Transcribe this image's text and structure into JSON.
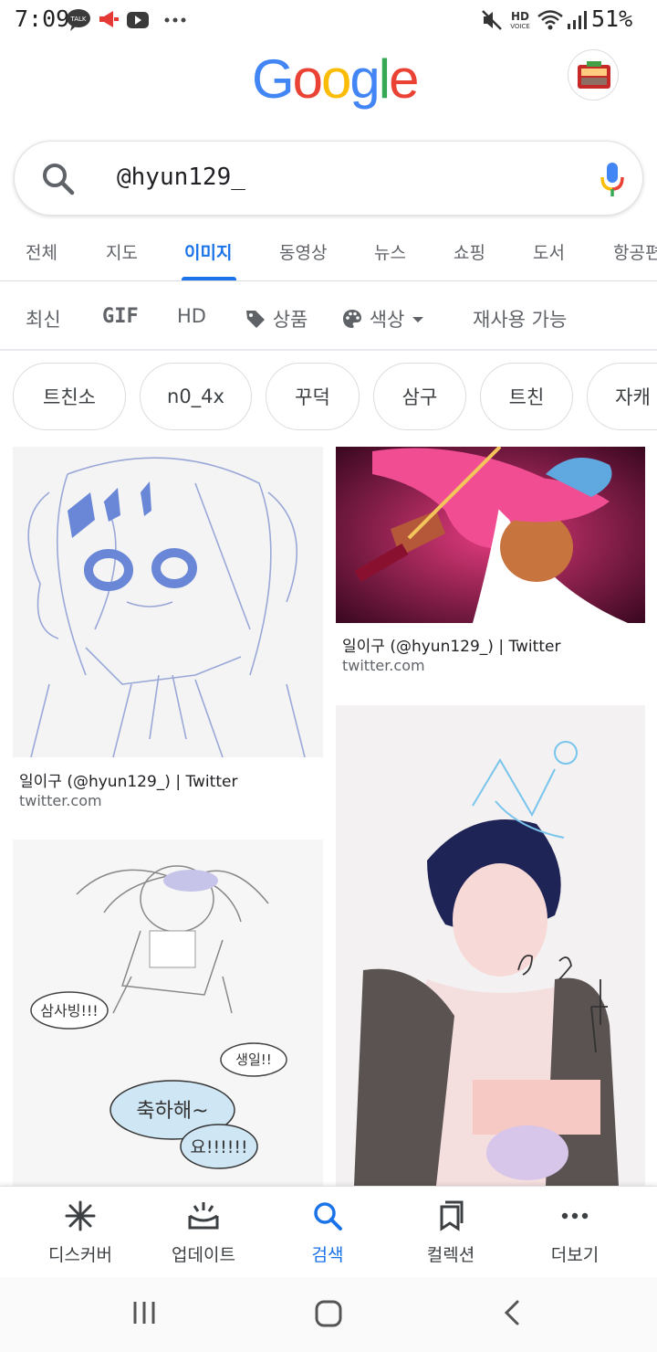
{
  "status_bar": {
    "time": "7:09",
    "battery": "51%",
    "icons": [
      "kakaotalk-icon",
      "megaphone-icon",
      "youtube-icon",
      "more-dots-icon",
      "mute-icon",
      "hd-voice-icon",
      "wifi-icon",
      "signal-icon",
      "battery-icon"
    ]
  },
  "header": {
    "logo_letters": [
      "G",
      "o",
      "o",
      "g",
      "l",
      "e"
    ],
    "logo_colors": [
      "#4285F4",
      "#EA4335",
      "#FBBC05",
      "#4285F4",
      "#34A853",
      "#EA4335"
    ]
  },
  "search": {
    "query": "@hyun129_"
  },
  "tabs": [
    {
      "label": "전체"
    },
    {
      "label": "지도"
    },
    {
      "label": "이미지",
      "active": true
    },
    {
      "label": "동영상"
    },
    {
      "label": "뉴스"
    },
    {
      "label": "쇼핑"
    },
    {
      "label": "도서"
    },
    {
      "label": "항공편"
    }
  ],
  "filters": {
    "recent": "최신",
    "gif": "GIF",
    "hd": "HD",
    "product": "상품",
    "color": "색상",
    "reuse": "재사용 가능"
  },
  "chips": [
    "트친소",
    "n0_4x",
    "꾸덕",
    "삼구",
    "트친",
    "자캐"
  ],
  "results": [
    {
      "title": "일이구 (@hyun129_) | Twitter",
      "source": "twitter.com"
    },
    {
      "title": "일이구 (@hyun129_) | Twitter",
      "source": "twitter.com"
    },
    {
      "drawn_text": [
        "삼사빙!!!",
        "생일!!",
        "축하해~",
        "요!!!!!!"
      ]
    },
    {
      "drawn_text": [
        "2",
        "3",
        "4"
      ]
    }
  ],
  "bottom_nav": [
    {
      "label": "디스커버",
      "icon": "asterisk-icon"
    },
    {
      "label": "업데이트",
      "icon": "updates-icon"
    },
    {
      "label": "검색",
      "icon": "search-icon",
      "active": true
    },
    {
      "label": "컬렉션",
      "icon": "collections-icon"
    },
    {
      "label": "더보기",
      "icon": "more-icon"
    }
  ],
  "colors": {
    "accent": "#1a73e8",
    "text": "#3c4043",
    "muted": "#5f6368"
  }
}
